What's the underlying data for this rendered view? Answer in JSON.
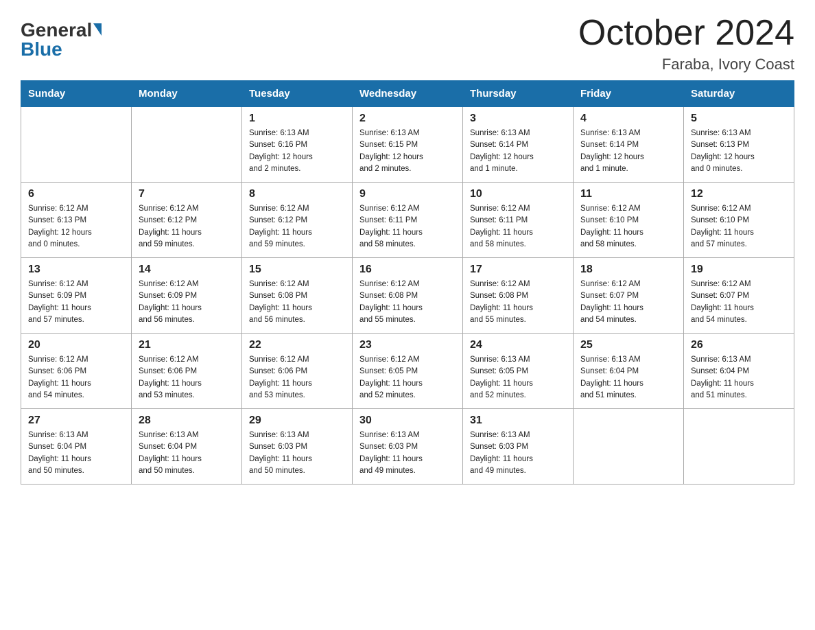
{
  "header": {
    "logo_general": "General",
    "logo_blue": "Blue",
    "month_title": "October 2024",
    "location": "Faraba, Ivory Coast"
  },
  "weekdays": [
    "Sunday",
    "Monday",
    "Tuesday",
    "Wednesday",
    "Thursday",
    "Friday",
    "Saturday"
  ],
  "weeks": [
    [
      {
        "day": "",
        "info": ""
      },
      {
        "day": "",
        "info": ""
      },
      {
        "day": "1",
        "info": "Sunrise: 6:13 AM\nSunset: 6:16 PM\nDaylight: 12 hours\nand 2 minutes."
      },
      {
        "day": "2",
        "info": "Sunrise: 6:13 AM\nSunset: 6:15 PM\nDaylight: 12 hours\nand 2 minutes."
      },
      {
        "day": "3",
        "info": "Sunrise: 6:13 AM\nSunset: 6:14 PM\nDaylight: 12 hours\nand 1 minute."
      },
      {
        "day": "4",
        "info": "Sunrise: 6:13 AM\nSunset: 6:14 PM\nDaylight: 12 hours\nand 1 minute."
      },
      {
        "day": "5",
        "info": "Sunrise: 6:13 AM\nSunset: 6:13 PM\nDaylight: 12 hours\nand 0 minutes."
      }
    ],
    [
      {
        "day": "6",
        "info": "Sunrise: 6:12 AM\nSunset: 6:13 PM\nDaylight: 12 hours\nand 0 minutes."
      },
      {
        "day": "7",
        "info": "Sunrise: 6:12 AM\nSunset: 6:12 PM\nDaylight: 11 hours\nand 59 minutes."
      },
      {
        "day": "8",
        "info": "Sunrise: 6:12 AM\nSunset: 6:12 PM\nDaylight: 11 hours\nand 59 minutes."
      },
      {
        "day": "9",
        "info": "Sunrise: 6:12 AM\nSunset: 6:11 PM\nDaylight: 11 hours\nand 58 minutes."
      },
      {
        "day": "10",
        "info": "Sunrise: 6:12 AM\nSunset: 6:11 PM\nDaylight: 11 hours\nand 58 minutes."
      },
      {
        "day": "11",
        "info": "Sunrise: 6:12 AM\nSunset: 6:10 PM\nDaylight: 11 hours\nand 58 minutes."
      },
      {
        "day": "12",
        "info": "Sunrise: 6:12 AM\nSunset: 6:10 PM\nDaylight: 11 hours\nand 57 minutes."
      }
    ],
    [
      {
        "day": "13",
        "info": "Sunrise: 6:12 AM\nSunset: 6:09 PM\nDaylight: 11 hours\nand 57 minutes."
      },
      {
        "day": "14",
        "info": "Sunrise: 6:12 AM\nSunset: 6:09 PM\nDaylight: 11 hours\nand 56 minutes."
      },
      {
        "day": "15",
        "info": "Sunrise: 6:12 AM\nSunset: 6:08 PM\nDaylight: 11 hours\nand 56 minutes."
      },
      {
        "day": "16",
        "info": "Sunrise: 6:12 AM\nSunset: 6:08 PM\nDaylight: 11 hours\nand 55 minutes."
      },
      {
        "day": "17",
        "info": "Sunrise: 6:12 AM\nSunset: 6:08 PM\nDaylight: 11 hours\nand 55 minutes."
      },
      {
        "day": "18",
        "info": "Sunrise: 6:12 AM\nSunset: 6:07 PM\nDaylight: 11 hours\nand 54 minutes."
      },
      {
        "day": "19",
        "info": "Sunrise: 6:12 AM\nSunset: 6:07 PM\nDaylight: 11 hours\nand 54 minutes."
      }
    ],
    [
      {
        "day": "20",
        "info": "Sunrise: 6:12 AM\nSunset: 6:06 PM\nDaylight: 11 hours\nand 54 minutes."
      },
      {
        "day": "21",
        "info": "Sunrise: 6:12 AM\nSunset: 6:06 PM\nDaylight: 11 hours\nand 53 minutes."
      },
      {
        "day": "22",
        "info": "Sunrise: 6:12 AM\nSunset: 6:06 PM\nDaylight: 11 hours\nand 53 minutes."
      },
      {
        "day": "23",
        "info": "Sunrise: 6:12 AM\nSunset: 6:05 PM\nDaylight: 11 hours\nand 52 minutes."
      },
      {
        "day": "24",
        "info": "Sunrise: 6:13 AM\nSunset: 6:05 PM\nDaylight: 11 hours\nand 52 minutes."
      },
      {
        "day": "25",
        "info": "Sunrise: 6:13 AM\nSunset: 6:04 PM\nDaylight: 11 hours\nand 51 minutes."
      },
      {
        "day": "26",
        "info": "Sunrise: 6:13 AM\nSunset: 6:04 PM\nDaylight: 11 hours\nand 51 minutes."
      }
    ],
    [
      {
        "day": "27",
        "info": "Sunrise: 6:13 AM\nSunset: 6:04 PM\nDaylight: 11 hours\nand 50 minutes."
      },
      {
        "day": "28",
        "info": "Sunrise: 6:13 AM\nSunset: 6:04 PM\nDaylight: 11 hours\nand 50 minutes."
      },
      {
        "day": "29",
        "info": "Sunrise: 6:13 AM\nSunset: 6:03 PM\nDaylight: 11 hours\nand 50 minutes."
      },
      {
        "day": "30",
        "info": "Sunrise: 6:13 AM\nSunset: 6:03 PM\nDaylight: 11 hours\nand 49 minutes."
      },
      {
        "day": "31",
        "info": "Sunrise: 6:13 AM\nSunset: 6:03 PM\nDaylight: 11 hours\nand 49 minutes."
      },
      {
        "day": "",
        "info": ""
      },
      {
        "day": "",
        "info": ""
      }
    ]
  ]
}
